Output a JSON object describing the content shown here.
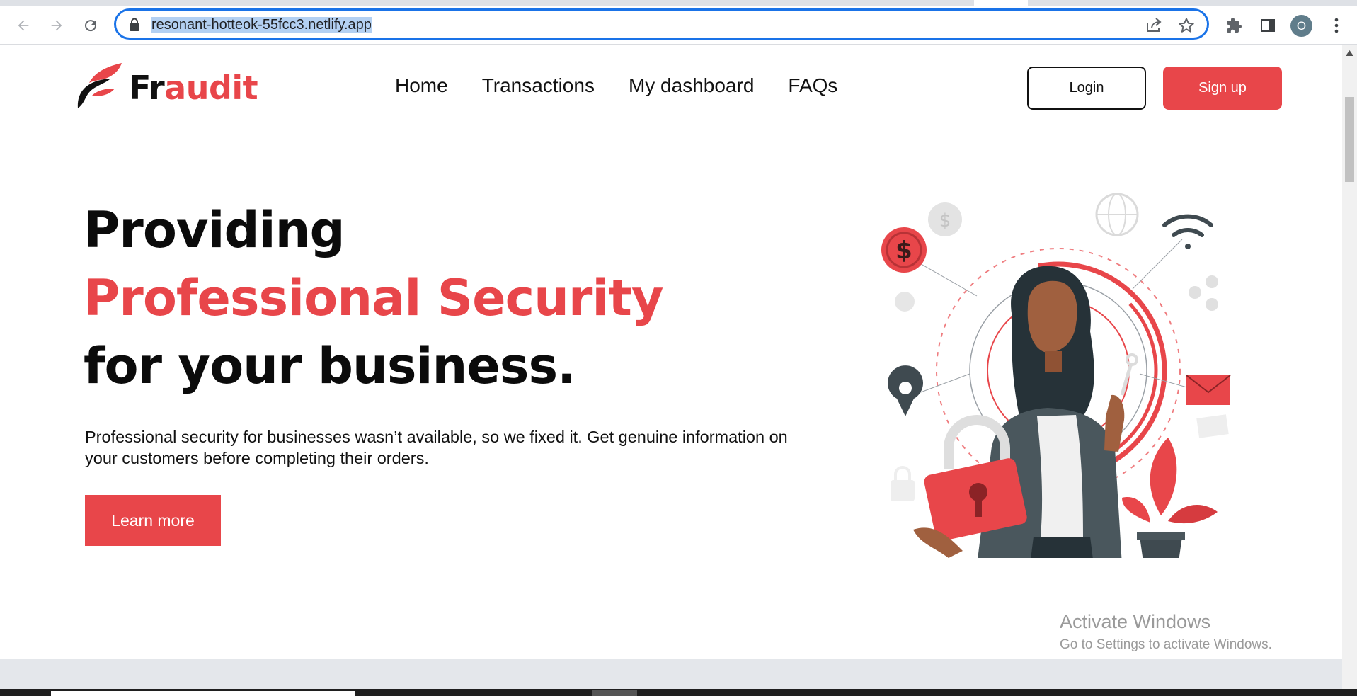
{
  "browser": {
    "url": "resonant-hotteok-55fcc3.netlify.app",
    "profile_initial": "O",
    "icons": [
      "back-icon",
      "forward-icon",
      "reload-icon",
      "lock-icon",
      "share-icon",
      "star-icon",
      "extensions-icon",
      "side-panel-icon",
      "kebab-menu-icon"
    ]
  },
  "nav": {
    "brand_prefix": "Fr",
    "brand_suffix": "audit",
    "links": [
      "Home",
      "Transactions",
      "My dashboard",
      "FAQs"
    ],
    "login_label": "Login",
    "signup_label": "Sign up"
  },
  "hero": {
    "line1": "Providing",
    "line2": "Professional Security",
    "line3": "for your business.",
    "description": "Professional security for businesses wasn’t available, so we fixed it. Get genuine information on your customers before completing their orders.",
    "cta_label": "Learn more"
  },
  "watermark": {
    "title": "Activate Windows",
    "subtitle": "Go to Settings to activate Windows."
  },
  "colors": {
    "accent": "#e8464a",
    "text": "#111111",
    "omnibox_focus": "#1a73e8"
  }
}
